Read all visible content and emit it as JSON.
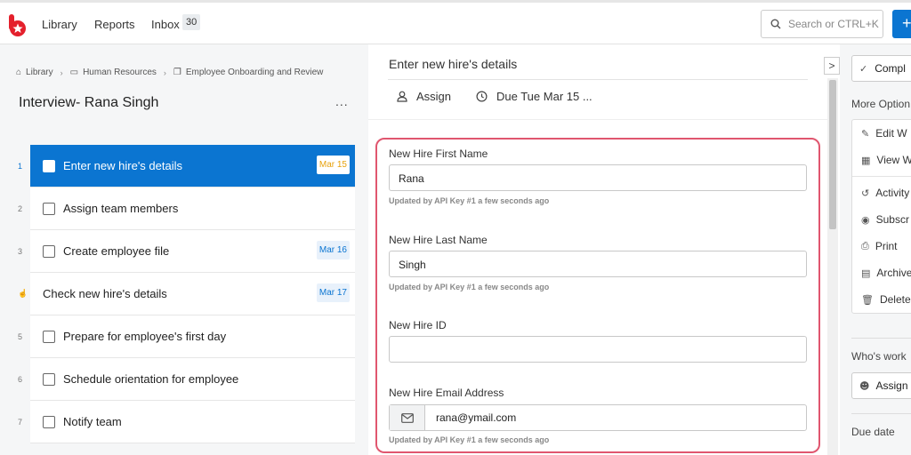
{
  "header": {
    "nav": [
      "Library",
      "Reports",
      "Inbox"
    ],
    "inbox_count": "30",
    "search_placeholder": "Search or CTRL+K",
    "plus_label": "+"
  },
  "breadcrumb": [
    "Library",
    "Human Resources",
    "Employee Onboarding and Review"
  ],
  "workflow_title": "Interview- Rana Singh",
  "more_label": "...",
  "tasks": [
    {
      "num": "1",
      "label": "Enter new hire's details",
      "due": "Mar 15"
    },
    {
      "num": "2",
      "label": "Assign team members",
      "due": ""
    },
    {
      "num": "3",
      "label": "Create employee file",
      "due": "Mar 16"
    },
    {
      "num": "",
      "label": "Check new hire's details",
      "due": "Mar 17"
    },
    {
      "num": "5",
      "label": "Prepare for employee's first day",
      "due": ""
    },
    {
      "num": "6",
      "label": "Schedule orientation for employee",
      "due": ""
    },
    {
      "num": "7",
      "label": "Notify team",
      "due": ""
    }
  ],
  "step": {
    "title": "Enter new hire's details",
    "assign_label": "Assign",
    "due_label": "Due Tue Mar 15 ...",
    "collapse_label": ">"
  },
  "form": {
    "first_name_label": "New Hire First Name",
    "first_name_value": "Rana",
    "first_name_note": "Updated by API Key #1 a few seconds ago",
    "last_name_label": "New Hire Last Name",
    "last_name_value": "Singh",
    "last_name_note": "Updated by API Key #1 a few seconds ago",
    "id_label": "New Hire ID",
    "id_value": "",
    "email_label": "New Hire Email Address",
    "email_value": "rana@ymail.com",
    "email_note": "Updated by API Key #1 a few seconds ago"
  },
  "right": {
    "complete_label": "Compl",
    "more_options_label": "More Option",
    "options": [
      "Edit W",
      "View W",
      "Activity",
      "Subscr",
      "Print",
      "Archive",
      "Delete"
    ],
    "whos_working_label": "Who's work",
    "assign_label": "Assign",
    "due_date_label": "Due date"
  },
  "colors": {
    "accent": "#0b75d1",
    "highlight_border": "#e0566f",
    "due_active": "#e7a20d"
  }
}
